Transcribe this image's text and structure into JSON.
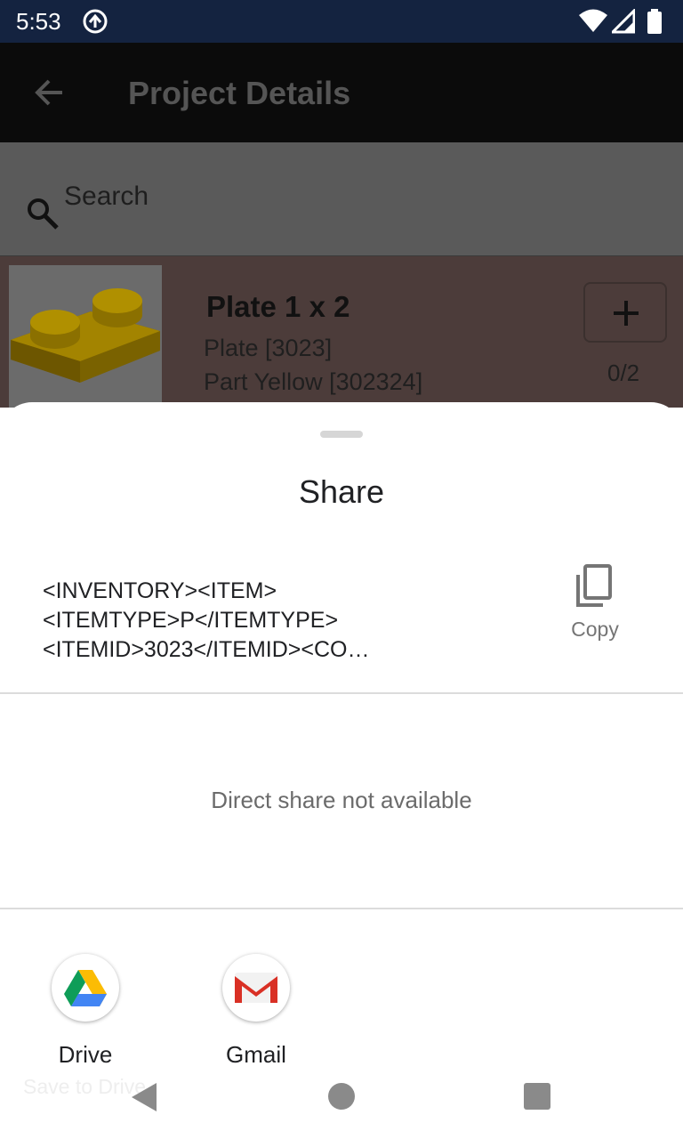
{
  "status_bar": {
    "time": "5:53",
    "icons": [
      "sync-circle-icon",
      "wifi-icon",
      "signal-icon",
      "battery-icon"
    ]
  },
  "app_bar": {
    "title": "Project Details",
    "back_icon": "arrow-left-icon"
  },
  "search": {
    "placeholder": "Search",
    "icon": "search-icon"
  },
  "part": {
    "name": "Plate 1 x 2",
    "type": "Plate [3023]",
    "color": "Part Yellow [302324]",
    "count": "0/2",
    "add_icon": "plus-icon",
    "image_color": "#f2d400"
  },
  "share_sheet": {
    "title": "Share",
    "preview_text": "<INVENTORY><ITEM><ITEMTYPE>P</ITEMTYPE><ITEMID>3023</ITEMID><CO…",
    "copy_label": "Copy",
    "direct_share": "Direct share not available",
    "apps": [
      {
        "label": "Drive",
        "icon": "google-drive-icon"
      },
      {
        "label": "Gmail",
        "icon": "gmail-icon"
      }
    ],
    "faded_label": "Save to Drive"
  },
  "nav_bar": {
    "icons": [
      "nav-back-icon",
      "nav-home-icon",
      "nav-recents-icon"
    ]
  },
  "colors": {
    "status_bar": "#142340",
    "app_bar": "#0b0b0b",
    "sheet": "#ffffff",
    "scrim_row": "#4c3c3a"
  }
}
